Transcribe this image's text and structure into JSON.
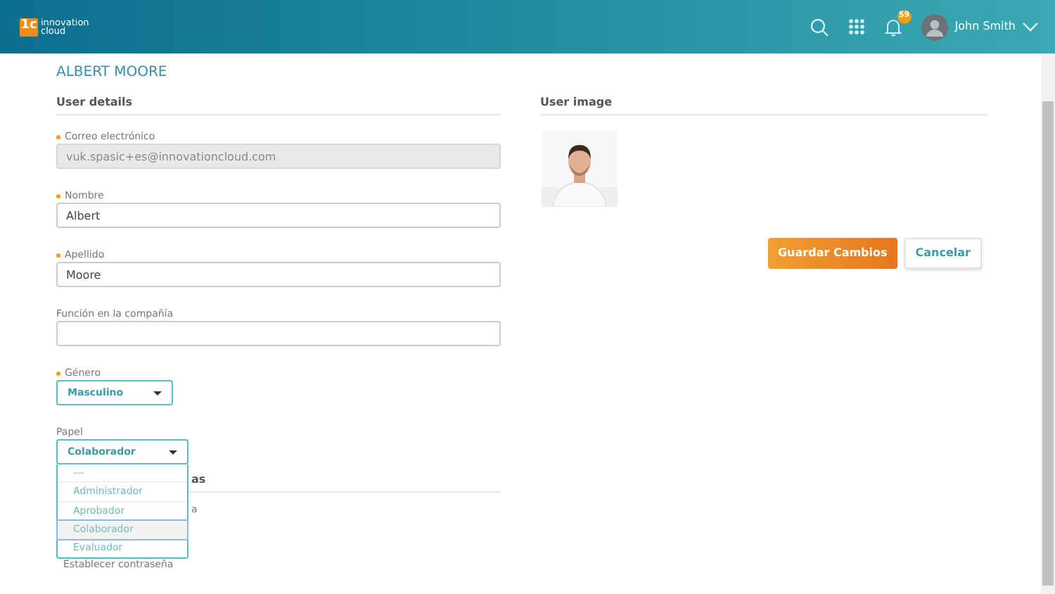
{
  "header": {
    "logo_mark": "1c",
    "logo_text_1": "innovation",
    "logo_text_2": "cloud",
    "notifications_count": "59",
    "user_name": "John Smith"
  },
  "page_title": "ALBERT MOORE",
  "user_details": {
    "title": "User details",
    "fields": [
      {
        "kind": "input",
        "label": "Correo electrónico",
        "required": true,
        "value": "vuk.spasic+es@innovationcloud.com",
        "disabled": true
      },
      {
        "kind": "input",
        "label": "Nombre",
        "required": true,
        "value": "Albert",
        "disabled": false
      },
      {
        "kind": "input",
        "label": "Apellido",
        "required": true,
        "value": "Moore",
        "disabled": false
      },
      {
        "kind": "input",
        "label": "Función en la compañía",
        "required": false,
        "disabled": false
      },
      {
        "kind": "select",
        "label": "Género",
        "required": true,
        "value": "Masculino",
        "expanded": false
      },
      {
        "kind": "select",
        "label": "Papel",
        "required": false,
        "value": "Colaborador",
        "expanded": true,
        "options": [
          {
            "label": "---",
            "selected": false
          },
          {
            "label": "Administrador",
            "selected": false
          },
          {
            "label": "Aprobador",
            "selected": false
          },
          {
            "label": "Colaborador",
            "selected": true
          },
          {
            "label": "Evaluador",
            "selected": false
          }
        ]
      }
    ]
  },
  "hidden_section": {
    "title_fragment": "as",
    "line_fragment": "a",
    "link": "Establecer contraseña"
  },
  "user_image": {
    "title": "User image"
  },
  "buttons": [
    {
      "kind": "primary",
      "label": "Guardar Cambios"
    },
    {
      "kind": "secondary",
      "label": "Cancelar"
    }
  ]
}
